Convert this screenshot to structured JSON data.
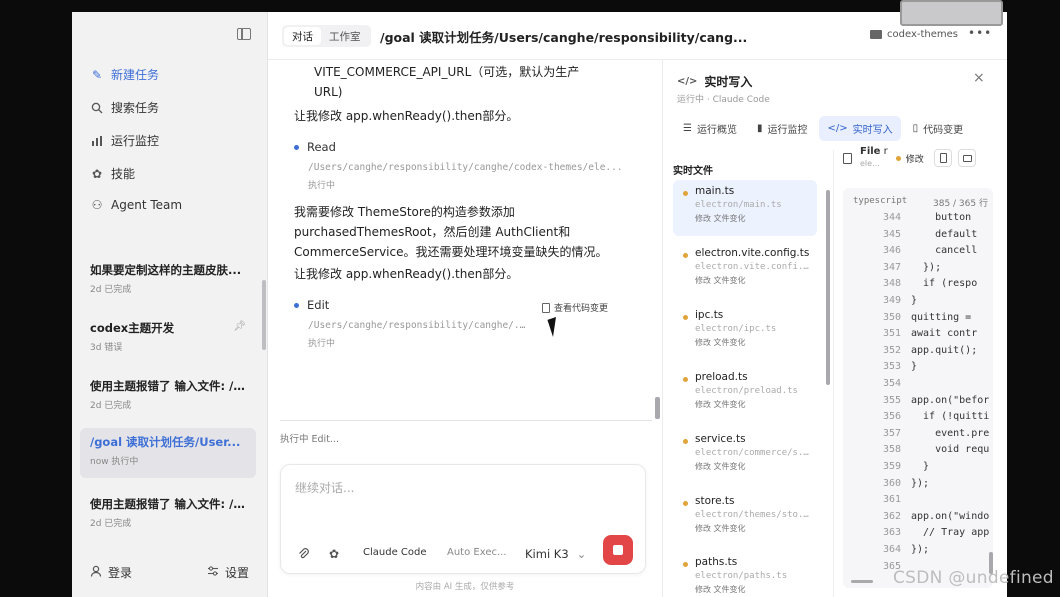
{
  "sidebar": {
    "nav": [
      {
        "label": "新建任务",
        "icon": "edit-icon"
      },
      {
        "label": "搜索任务",
        "icon": "search-icon"
      },
      {
        "label": "运行监控",
        "icon": "bar-chart-icon"
      },
      {
        "label": "技能",
        "icon": "puzzle-icon"
      },
      {
        "label": "Agent Team",
        "icon": "team-icon"
      }
    ],
    "tasks": [
      {
        "title": "如果要定制这样的主题皮肤...",
        "meta": "2d  已完成"
      },
      {
        "title": "codex主题开发",
        "meta": "3d  错误"
      },
      {
        "title": "使用主题报错了 输入文件: /...",
        "meta": "2d  已完成"
      },
      {
        "title": "/goal 读取计划任务/User...",
        "meta": "now  执行中"
      },
      {
        "title": "使用主题报错了 输入文件: /...",
        "meta": "2d  已完成"
      }
    ],
    "login": "登录",
    "settings": "设置"
  },
  "header": {
    "tab_chat": "对话",
    "tab_workspace": "工作室",
    "title": "/goal 读取计划任务/Users/canghe/responsibility/cang...",
    "folder": "codex-themes",
    "more": "•••"
  },
  "chat": {
    "line1": "VITE_COMMERCE_API_URL（可选，默认为生产",
    "line2": "URL)",
    "line3": "让我修改 app.whenReady().then部分。",
    "tool1_name": "Read",
    "tool1_path": "/Users/canghe/responsibility/canghe/codex-themes/ele...",
    "tool1_status": "执行中",
    "para": "我需要修改 ThemeStore的构造参数添加 purchasedThemesRoot，然后创建 AuthClient和 CommerceService。我还需要处理环境变量缺失的情况。",
    "line4": "让我修改 app.whenReady().then部分。",
    "tool2_name": "Edit",
    "tool2_path": "/Users/canghe/responsibility/canghe/...",
    "tool2_status": "执行中",
    "view_changes": "查看代码变更",
    "running": "执行中 Edit...",
    "placeholder": "继续对话...",
    "agent": "Claude Code",
    "auto": "Auto Exec...",
    "model": "Kimi K3",
    "footer": "内容由 AI 生成，仅供参考"
  },
  "panel": {
    "title": "实时写入",
    "subtitle": "运行中 · Claude Code",
    "tabs": [
      "运行概览",
      "运行监控",
      "实时写入",
      "代码变更"
    ],
    "files_header": "实时文件",
    "files": [
      {
        "name": "main.ts",
        "path": "electron/main.ts",
        "status": "修改  文件变化"
      },
      {
        "name": "electron.vite.config.ts",
        "path": "electron.vite.confi...",
        "status": "修改  文件变化"
      },
      {
        "name": "ipc.ts",
        "path": "electron/ipc.ts",
        "status": "修改  文件变化"
      },
      {
        "name": "preload.ts",
        "path": "electron/preload.ts",
        "status": "修改  文件变化"
      },
      {
        "name": "service.ts",
        "path": "electron/commerce/s...",
        "status": "修改  文件变化"
      },
      {
        "name": "store.ts",
        "path": "electron/themes/sto...",
        "status": "修改  文件变化"
      },
      {
        "name": "paths.ts",
        "path": "electron/paths.ts",
        "status": "修改  文件变化"
      }
    ],
    "file_label": "File",
    "file_r": "r",
    "file_sub": "ele...",
    "file_mod": "修改",
    "code_lang": "typescript",
    "code_lines_info": "385 / 365 行",
    "code": [
      {
        "n": "344",
        "t": "    button"
      },
      {
        "n": "345",
        "t": "    default"
      },
      {
        "n": "346",
        "t": "    cancell"
      },
      {
        "n": "347",
        "t": "  });"
      },
      {
        "n": "348",
        "t": "  if (respo"
      },
      {
        "n": "349",
        "t": "}"
      },
      {
        "n": "350",
        "t": "quitting ="
      },
      {
        "n": "351",
        "t": "await contr"
      },
      {
        "n": "352",
        "t": "app.quit();"
      },
      {
        "n": "353",
        "t": "}"
      },
      {
        "n": "354",
        "t": ""
      },
      {
        "n": "355",
        "t": "app.on(\"befor"
      },
      {
        "n": "356",
        "t": "  if (!quitti"
      },
      {
        "n": "357",
        "t": "    event.pre"
      },
      {
        "n": "358",
        "t": "    void requ"
      },
      {
        "n": "359",
        "t": "  }"
      },
      {
        "n": "360",
        "t": "});"
      },
      {
        "n": "361",
        "t": ""
      },
      {
        "n": "362",
        "t": "app.on(\"windo"
      },
      {
        "n": "363",
        "t": "  // Tray app"
      },
      {
        "n": "364",
        "t": "});"
      },
      {
        "n": "365",
        "t": ""
      }
    ]
  },
  "watermark": "CSDN @undefined",
  "colors": {
    "accent": "#3d6fd6",
    "send": "#e34646",
    "status_dot": "#e0a43a"
  }
}
